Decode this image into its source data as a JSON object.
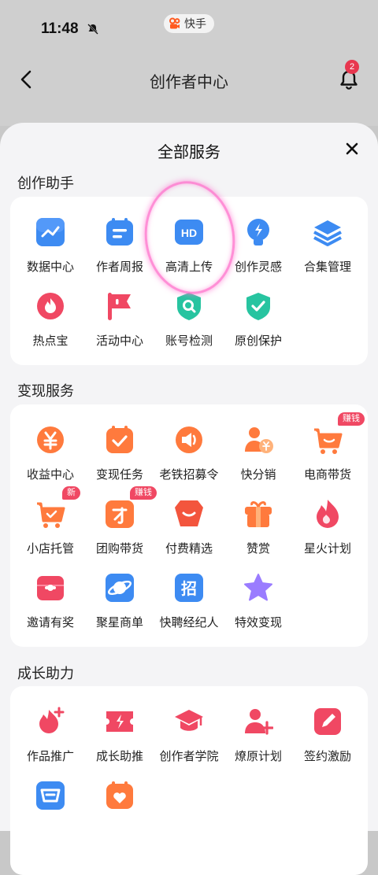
{
  "status": {
    "time": "11:48",
    "app_name": "快手"
  },
  "header": {
    "title": "创作者中心",
    "notification_count": "2"
  },
  "sheet": {
    "title": "全部服务",
    "sections": [
      {
        "title": "创作助手",
        "items": [
          {
            "label": "数据中心",
            "icon": "chart-icon"
          },
          {
            "label": "作者周报",
            "icon": "calendar-report-icon"
          },
          {
            "label": "高清上传",
            "icon": "hd-icon"
          },
          {
            "label": "创作灵感",
            "icon": "lightbulb-icon"
          },
          {
            "label": "合集管理",
            "icon": "layers-icon"
          },
          {
            "label": "热点宝",
            "icon": "flame-icon"
          },
          {
            "label": "活动中心",
            "icon": "flag-icon"
          },
          {
            "label": "账号检测",
            "icon": "shield-search-icon"
          },
          {
            "label": "原创保护",
            "icon": "shield-check-icon"
          }
        ]
      },
      {
        "title": "变现服务",
        "items": [
          {
            "label": "收益中心",
            "icon": "yen-coin-icon"
          },
          {
            "label": "变现任务",
            "icon": "task-check-icon"
          },
          {
            "label": "老铁招募令",
            "icon": "megaphone-icon"
          },
          {
            "label": "快分销",
            "icon": "person-yen-icon"
          },
          {
            "label": "电商带货",
            "icon": "cart-icon",
            "tag": "赚钱"
          },
          {
            "label": "小店托管",
            "icon": "cart-check-icon",
            "tag": "新"
          },
          {
            "label": "团购带货",
            "icon": "group-buy-icon",
            "tag": "赚钱"
          },
          {
            "label": "付费精选",
            "icon": "paid-select-icon"
          },
          {
            "label": "赞赏",
            "icon": "gift-icon"
          },
          {
            "label": "星火计划",
            "icon": "spark-flame-icon"
          },
          {
            "label": "邀请有奖",
            "icon": "invite-envelope-icon"
          },
          {
            "label": "聚星商单",
            "icon": "planet-icon"
          },
          {
            "label": "快聘经纪人",
            "icon": "recruit-icon"
          },
          {
            "label": "特效变现",
            "icon": "star-icon"
          }
        ]
      },
      {
        "title": "成长助力",
        "items": [
          {
            "label": "作品推广",
            "icon": "flame-plus-icon"
          },
          {
            "label": "成长助推",
            "icon": "ticket-bolt-icon"
          },
          {
            "label": "创作者学院",
            "icon": "graduation-cap-icon"
          },
          {
            "label": "燎原计划",
            "icon": "person-plus-icon"
          },
          {
            "label": "签约激励",
            "icon": "contract-pen-icon"
          },
          {
            "label": "",
            "icon": "basket-icon"
          },
          {
            "label": "",
            "icon": "calendar-heart-icon"
          }
        ]
      }
    ]
  },
  "colors": {
    "blue": "#3d8bf2",
    "orange": "#ff7a3d",
    "pink": "#f04863",
    "green": "#27c4a0",
    "purple": "#9a7cff"
  }
}
